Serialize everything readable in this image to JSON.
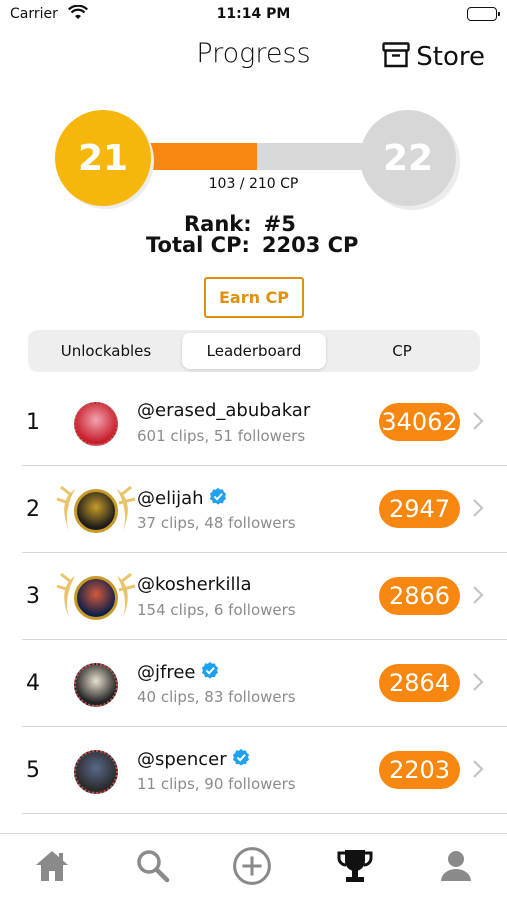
{
  "status_bar": {
    "carrier": "Carrier",
    "time": "11:14 PM"
  },
  "header": {
    "title": "Progress",
    "store_label": "Store",
    "store_icon": "box-icon"
  },
  "level": {
    "current": "21",
    "next": "22",
    "progress_text": "103 / 210 CP",
    "progress_fraction": 0.49,
    "colors": {
      "current": "#f6b60b",
      "fill": "#f7870e",
      "next": "#d7d7d7"
    }
  },
  "stats": {
    "rank_label": "Rank:",
    "rank_value": "#5",
    "total_label": "Total CP:",
    "total_value": "2203 CP"
  },
  "earn_button": "Earn CP",
  "segments": {
    "items": [
      "Unlockables",
      "Leaderboard",
      "CP"
    ],
    "selected": "Leaderboard"
  },
  "leaderboard": [
    {
      "rank": "1",
      "username": "@erased_abubakar",
      "meta": "601 clips, 51 followers",
      "score": "34062",
      "verified": false,
      "laurel": false
    },
    {
      "rank": "2",
      "username": "@elijah",
      "meta": "37 clips, 48 followers",
      "score": "2947",
      "verified": true,
      "laurel": true
    },
    {
      "rank": "3",
      "username": "@kosherkilla",
      "meta": "154 clips, 6 followers",
      "score": "2866",
      "verified": false,
      "laurel": true
    },
    {
      "rank": "4",
      "username": "@jfree",
      "meta": "40 clips, 83 followers",
      "score": "2864",
      "verified": true,
      "laurel": false
    },
    {
      "rank": "5",
      "username": "@spencer",
      "meta": "11 clips, 90 followers",
      "score": "2203",
      "verified": true,
      "laurel": false
    }
  ],
  "tabbar": {
    "items": [
      "home-icon",
      "search-icon",
      "add-icon",
      "trophy-icon",
      "profile-icon"
    ],
    "selected": "trophy-icon"
  },
  "colors": {
    "accent": "#f7870e",
    "verified": "#1da1f2",
    "earn_border": "#e0900f"
  }
}
